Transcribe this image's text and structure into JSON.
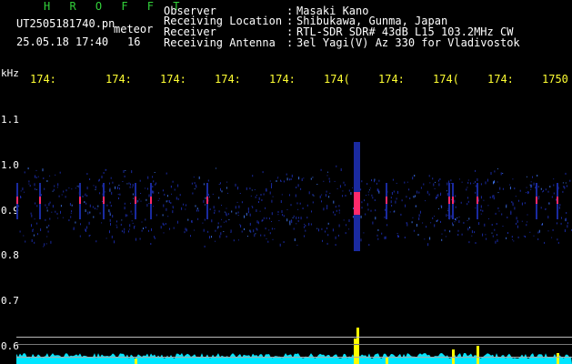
{
  "header": {
    "title": "H R O F F T",
    "filename": "UT2505181740.pn",
    "meteor_label": "meteor",
    "datetime": "25.05.18 17:40",
    "count": "16",
    "meta": [
      {
        "key": "Observer",
        "value": "Masaki Kano"
      },
      {
        "key": "Receiving Location",
        "value": "Shibukawa, Gunma, Japan"
      },
      {
        "key": "Receiver",
        "value": "RTL-SDR SDR# 43dB L15 103.2MHz CW"
      },
      {
        "key": "Receiving Antenna",
        "value": "3el Yagi(V) Az 330 for Vladivostok"
      }
    ]
  },
  "axes": {
    "y_unit": "kHz",
    "x_ticks": [
      "174:",
      "174:",
      "174:",
      "174:",
      "174:",
      "174(",
      "174:",
      "174(",
      "174:",
      "1750"
    ],
    "y_ticks": [
      "1.1",
      "1.0",
      "0.9",
      "0.8",
      "0.7",
      "0.6"
    ]
  },
  "colors": {
    "title": "#32d13a",
    "tick_x": "#ffff33",
    "background": "#000000",
    "signal_hot": "#ff2a6a",
    "signal_cold": "#1a2aa0",
    "trace": "#00e5ff",
    "meteor_echo": "#ffff00"
  },
  "chart_data": {
    "type": "heatmap",
    "meteor_echo_columns": [
      18,
      43,
      87,
      113,
      148,
      165,
      227,
      389,
      392,
      424,
      493,
      497,
      524,
      589,
      612
    ]
  }
}
